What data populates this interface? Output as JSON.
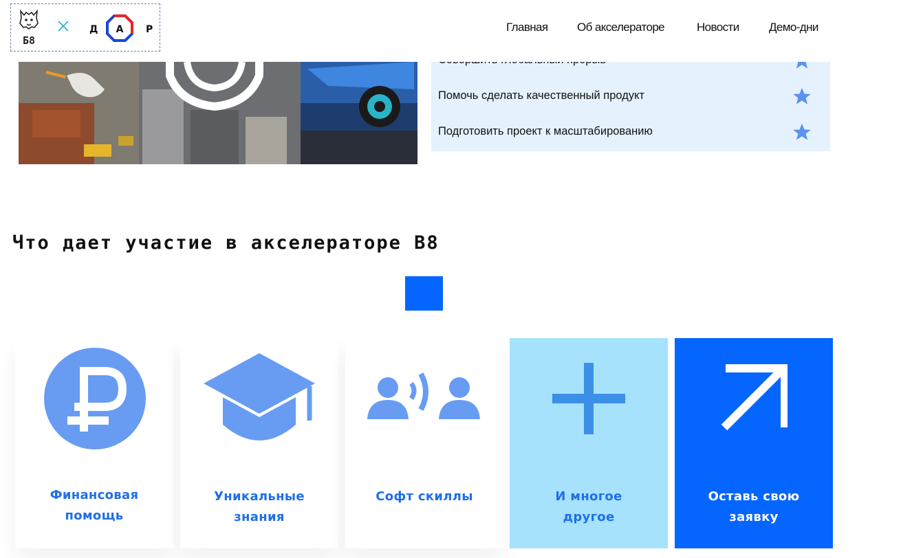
{
  "header": {
    "logo_text": "Б8",
    "partner_logo_letters": [
      "Д",
      "А",
      "Р"
    ],
    "nav": [
      "Главная",
      "Об акселераторе",
      "Новости",
      "Демо-дни"
    ]
  },
  "goals": {
    "items": [
      "Совершить глобальный прорыв",
      "Помочь сделать качественный продукт",
      "Подготовить проект к масштабированию"
    ],
    "icon": "star-icon"
  },
  "benefits": {
    "title": "Что дает участие в акселераторе B8",
    "cards": [
      {
        "line1": "Финансовая",
        "line2": "помощь",
        "icon": "ruble-icon"
      },
      {
        "line1": "Уникальные",
        "line2": "знания",
        "icon": "graduation-cap-icon"
      },
      {
        "line1": "Софт скиллы",
        "line2": "",
        "icon": "speaking-people-icon"
      },
      {
        "line1": "И многое",
        "line2": "другое",
        "icon": "plus-icon"
      },
      {
        "line1": "Оставь свою",
        "line2": "заявку",
        "icon": "arrow-up-right-icon"
      }
    ]
  },
  "colors": {
    "accent_blue": "#0566ff",
    "icon_blue": "#679cf2",
    "label_blue": "#1f6fe8",
    "light_cyan": "#a7e2fd",
    "panel_blue": "#e5f1fd"
  }
}
